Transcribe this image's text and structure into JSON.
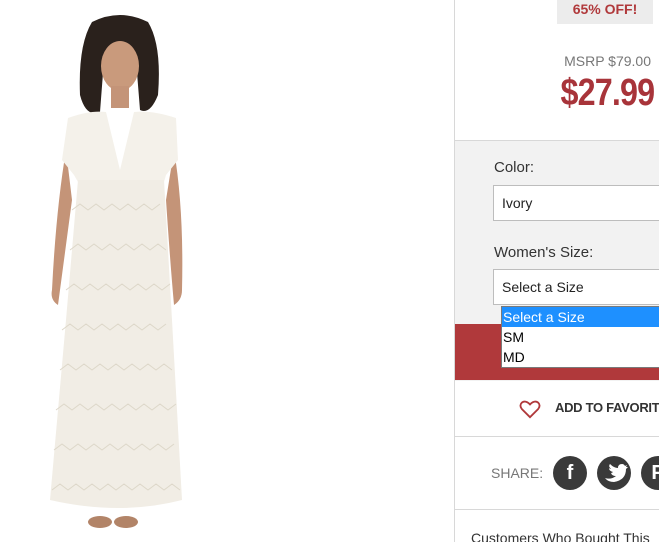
{
  "product": {
    "discount_badge": "65% OFF!",
    "msrp": "MSRP $79.00",
    "price": "$27.99"
  },
  "options": {
    "color_label": "Color:",
    "color_value": "Ivory",
    "size_label": "Women's Size:",
    "size_value": "Select a Size",
    "size_options": [
      "Select a Size",
      "SM",
      "MD"
    ]
  },
  "actions": {
    "favorites_label": "ADD TO FAVORITES"
  },
  "share": {
    "label": "SHARE:",
    "icons": [
      "facebook-icon",
      "twitter-icon",
      "pinterest-icon"
    ]
  },
  "footer": {
    "text": "Customers Who Bought This"
  },
  "colors": {
    "accent": "#b0393b",
    "selected_option": "#1e90ff"
  }
}
